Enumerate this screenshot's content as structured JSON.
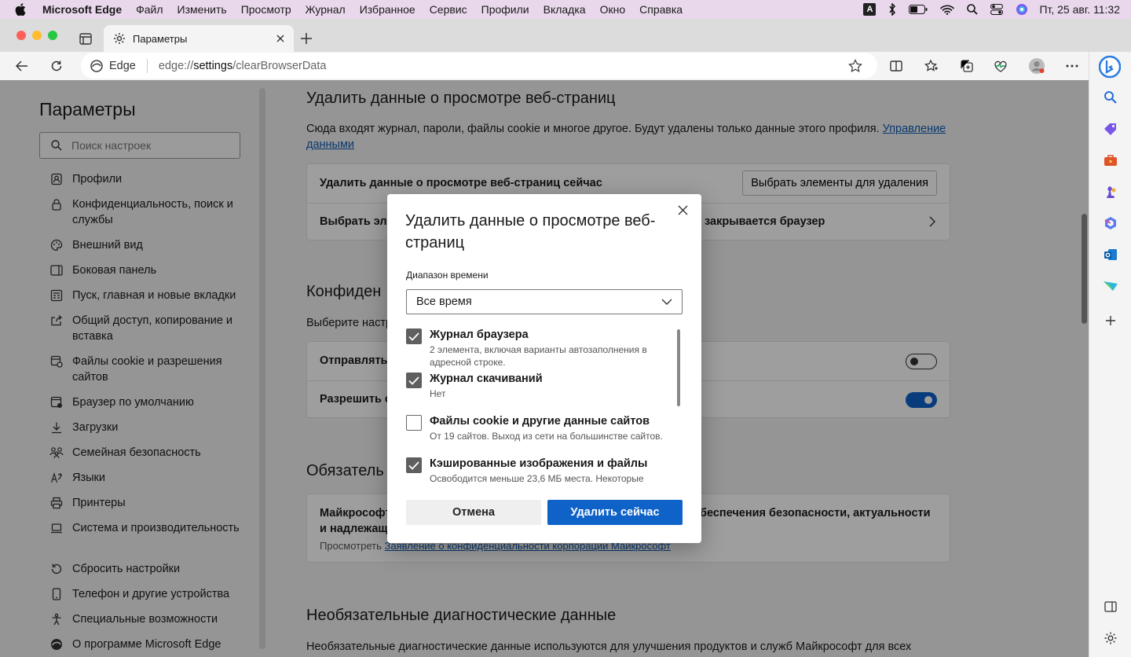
{
  "menubar": {
    "app": "Microsoft Edge",
    "items": [
      "Файл",
      "Изменить",
      "Просмотр",
      "Журнал",
      "Избранное",
      "Сервис",
      "Профили",
      "Вкладка",
      "Окно",
      "Справка"
    ],
    "input_indicator": "A",
    "clock": "Пт, 25 авг.  11:32"
  },
  "tab": {
    "title": "Параметры"
  },
  "address": {
    "site": "Edge",
    "url_prefix": "edge://",
    "url_main": "settings",
    "url_suffix": "/clearBrowserData"
  },
  "left": {
    "title": "Параметры",
    "search_placeholder": "Поиск настроек",
    "nav": [
      "Профили",
      "Конфиденциальность, поиск и службы",
      "Внешний вид",
      "Боковая панель",
      "Пуск, главная и новые вкладки",
      "Общий доступ, копирование и вставка",
      "Файлы cookie и разрешения сайтов",
      "Браузер по умолчанию",
      "Загрузки",
      "Семейная безопасность",
      "Языки",
      "Принтеры",
      "Система и производительность",
      "Сбросить настройки",
      "Телефон и другие устройства",
      "Специальные возможности",
      "О программе Microsoft Edge"
    ]
  },
  "main": {
    "clear_title": "Удалить данные о просмотре веб-страниц",
    "clear_desc": "Сюда входят журнал, пароли, файлы cookie и многое другое. Будут удалены только данные этого профиля.",
    "clear_link": "Управление данными",
    "clear_now": "Удалить данные о просмотре веб-страниц сейчас",
    "choose_button": "Выбрать элементы для удаления",
    "choose_close_left": "Выбрать эле",
    "choose_close_right": "закрывается браузер",
    "privacy_title": "Конфиден",
    "privacy_desc": "Выберите настр",
    "send_label": "Отправлять",
    "allow_label": "Разрешить с",
    "required_title": "Обязатель",
    "required_text_left": "Майкрософт",
    "required_text_right": "беспечения безопасности, актуальности",
    "required_text_left2": "и надлежащ",
    "required_view": "Просмотреть",
    "required_link": "Заявление о конфиденциальности корпорации Майкрософт",
    "optional_title": "Необязательные диагностические данные",
    "optional_desc": "Необязательные диагностические данные используются для улучшения продуктов и служб Майкрософт для всех",
    "toggles": {
      "send": false,
      "allow": true
    }
  },
  "dialog": {
    "title": "Удалить данные о просмотре веб-страниц",
    "range_label": "Диапазон времени",
    "range_value": "Все время",
    "options": [
      {
        "title": "Журнал браузера",
        "sub": "2 элемента, включая варианты автозаполнения в адресной строке.",
        "checked": true
      },
      {
        "title": "Журнал скачиваний",
        "sub": "Нет",
        "checked": true
      },
      {
        "title": "Файлы cookie и другие данные сайтов",
        "sub": "От 19 сайтов. Выход из сети на большинстве сайтов.",
        "checked": false
      },
      {
        "title": "Кэшированные изображения и файлы",
        "sub": "Освободится меньше 23,6 МБ места. Некоторые",
        "checked": true
      }
    ],
    "cancel": "Отмена",
    "delete": "Удалить сейчас"
  },
  "colors": {
    "accent": "#0f62c8",
    "menubar": "#e9d8ec",
    "link": "#0f5bb5"
  }
}
